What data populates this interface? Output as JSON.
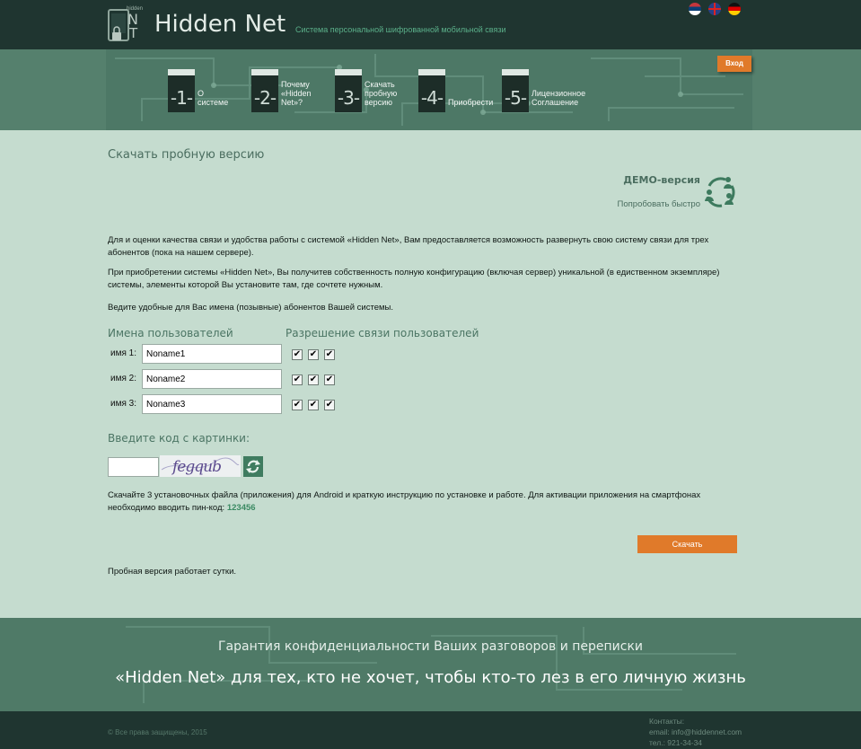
{
  "header": {
    "brand": "Hidden Net",
    "logo_text": "hidden",
    "tagline": "Система персональной шифрованной мобильной связи",
    "languages": [
      {
        "name": "serbian-flag-icon"
      },
      {
        "name": "english-flag-icon"
      },
      {
        "name": "german-flag-icon"
      }
    ]
  },
  "nav": {
    "steps": [
      {
        "num": "-1-",
        "label": "О системе"
      },
      {
        "num": "-2-",
        "label": "Почему «Hidden Net»?"
      },
      {
        "num": "-3-",
        "label": "Скачать пробную версию"
      },
      {
        "num": "-4-",
        "label": "Приобрести"
      },
      {
        "num": "-5-",
        "label": "Лицензионное Соглашение"
      }
    ],
    "login_label": "Вход"
  },
  "main": {
    "title": "Скачать пробную версию",
    "demo_title": "ДЕМО-версия",
    "demo_link": "Попробовать быстро",
    "para1": "Для и оценки качества связи и удобства работы с системой «Hidden Net», Вам предоставляется возможность развернуть свою систему связи для трех абонентов (пока на нашем сервере).",
    "para2": "При приобретении системы «Hidden Net», Вы получитев собственность полную конфигурацию (включая сервер) уникальной (в едиственном экземпляре) системы, элементы которой Вы установите там, где сочтете нужным.",
    "para3": "Ведите удобные для Вас имена (позывные) абонентов Вашей системы.",
    "col_names": "Имена пользователей",
    "col_perms": "Разрешение связи пользователей",
    "users": [
      {
        "label": "имя 1:",
        "value": "Noname1",
        "perms": [
          true,
          true,
          true
        ]
      },
      {
        "label": "имя 2:",
        "value": "Noname2",
        "perms": [
          true,
          true,
          true
        ]
      },
      {
        "label": "имя 3:",
        "value": "Noname3",
        "perms": [
          true,
          true,
          true
        ]
      }
    ],
    "captcha_label": "Введите код с картинки:",
    "captcha_text": "fegqub",
    "pin_text": "Скачайте 3 установочных файла (приложения) для Android и краткую инструкцию по установке и работе. Для активации приложения на смартфонах необходимо вводить пин-код:",
    "pin_code": "123456",
    "download_label": "Скачать",
    "trial_note": "Пробная версия работает сутки."
  },
  "banner": {
    "line1": "Гарантия конфиденциальности Ваших разговоров и переписки",
    "line2": "«Hidden Net» для тех, кто не хочет, чтобы кто-то лез в его личную жизнь"
  },
  "footer": {
    "copyright": "© Все права защищены, 2015",
    "contacts_title": "Контакты:",
    "email": "email: info@hiddennet.com",
    "phone": "тел.: 921-34-34"
  },
  "colors": {
    "dark": "#1f3530",
    "hero": "#55806d",
    "content_bg": "#c5dccf",
    "accent_orange": "#e07a2a",
    "heading_green": "#4b7564"
  }
}
